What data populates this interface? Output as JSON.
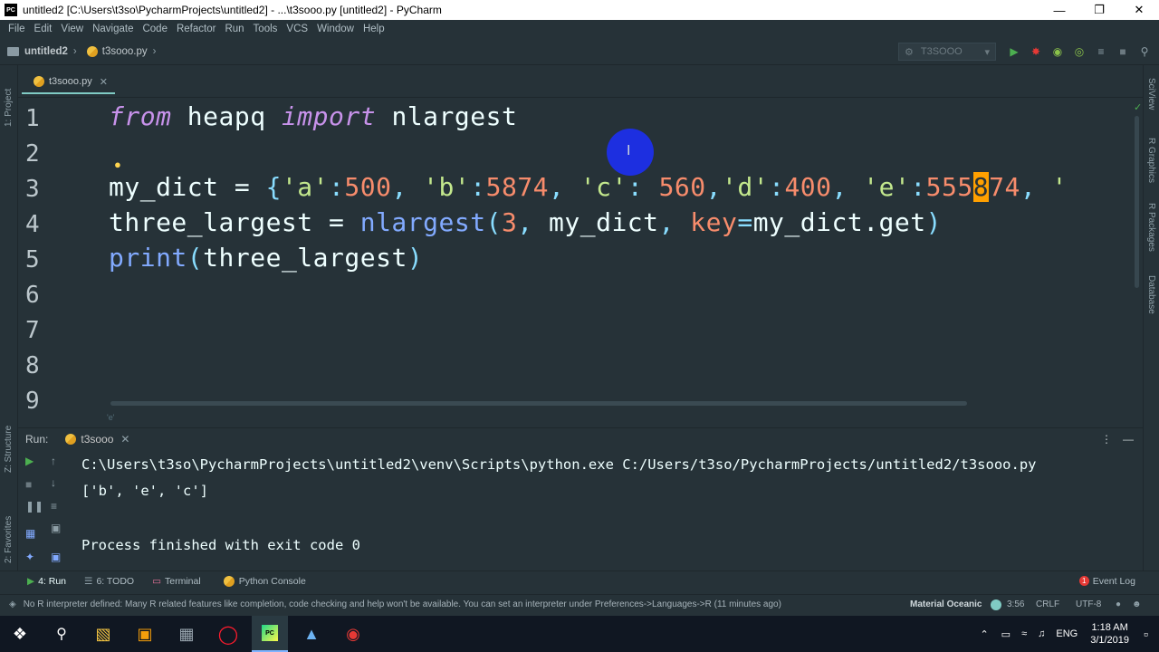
{
  "window": {
    "title": "untitled2 [C:\\Users\\t3so\\PycharmProjects\\untitled2] - ...\\t3sooo.py [untitled2] - PyCharm",
    "logo_text": "PC"
  },
  "menu": [
    "File",
    "Edit",
    "View",
    "Navigate",
    "Code",
    "Refactor",
    "Run",
    "Tools",
    "VCS",
    "Window",
    "Help"
  ],
  "navbar": {
    "project": "untitled2",
    "file": "t3sooo.py",
    "run_config": "T3SOOO"
  },
  "left_strip": {
    "project_label": "1: Project",
    "structure_label": "Z: Structure",
    "favorites_label": "2: Favorites"
  },
  "right_strip": {
    "sciview": "SciView",
    "r_graphics": "R Graphics",
    "r_packages": "R Packages",
    "database": "Database"
  },
  "editor_tab": {
    "label": "t3sooo.py"
  },
  "editor": {
    "line_numbers": [
      "1",
      "2",
      "3",
      "4",
      "5",
      "6",
      "7",
      "8",
      "9"
    ],
    "lines": {
      "l1": {
        "from": "from",
        "module": " heapq ",
        "import": "import",
        "name": " nlargest"
      },
      "l3": {
        "var": "my_dict = ",
        "open": "{",
        "k1": "'a'",
        "c1": ":",
        "v1": "500",
        "s1": ", ",
        "k2": "'b'",
        "c2": ":",
        "v2": "5874",
        "s2": ", ",
        "k3": "'c'",
        "c3": ": ",
        "v3": "560",
        "s3": ",",
        "k4": "'d'",
        "c4": ":",
        "v4": "400",
        "s4": ", ",
        "k5": "'e'",
        "c5": ":",
        "v5a": "555",
        "v5b": "8",
        "v5c": "74",
        "s5": ", ",
        "tail": "'"
      },
      "l4": {
        "var": "three_largest = ",
        "fn": "nlargest",
        "open": "(",
        "arg1": "3",
        "sep1": ", ",
        "arg2": "my_dict",
        "sep2": ", ",
        "kw": "key",
        "eq": "=",
        "arg3": "my_dict.get",
        "close": ")"
      },
      "l5": {
        "fn": "print",
        "open": "(",
        "arg": "three_largest",
        "close": ")"
      }
    },
    "breadcrumb_hint": "'e'"
  },
  "run_panel": {
    "label": "Run:",
    "tab": "t3sooo",
    "command": "C:\\Users\\t3so\\PycharmProjects\\untitled2\\venv\\Scripts\\python.exe C:/Users/t3so/PycharmProjects/untitled2/t3sooo.py",
    "output": "['b', 'e', 'c']",
    "exit": "Process finished with exit code 0"
  },
  "bottom_tabs": {
    "run": "4: Run",
    "todo": "6: TODO",
    "terminal": "Terminal",
    "python_console": "Python Console",
    "event_log": "Event Log",
    "event_log_count": "1"
  },
  "status": {
    "message": "No R interpreter defined: Many R related features like completion, code checking and help won't be available. You can set an interpreter under Preferences->Languages->R (11 minutes ago)",
    "theme": "Material Oceanic",
    "position": "3:56",
    "line_sep": "CRLF",
    "encoding": "UTF-8"
  },
  "taskbar": {
    "lang": "ENG",
    "time": "1:18 AM",
    "date": "3/1/2019"
  },
  "colors": {
    "editor_bg": "#263238",
    "keyword": "#c792ea",
    "string": "#c3e88d",
    "number": "#f78c6c",
    "function": "#82aaff",
    "cursor_highlight": "#ffa000",
    "click_indicator": "#1d2fe0"
  }
}
